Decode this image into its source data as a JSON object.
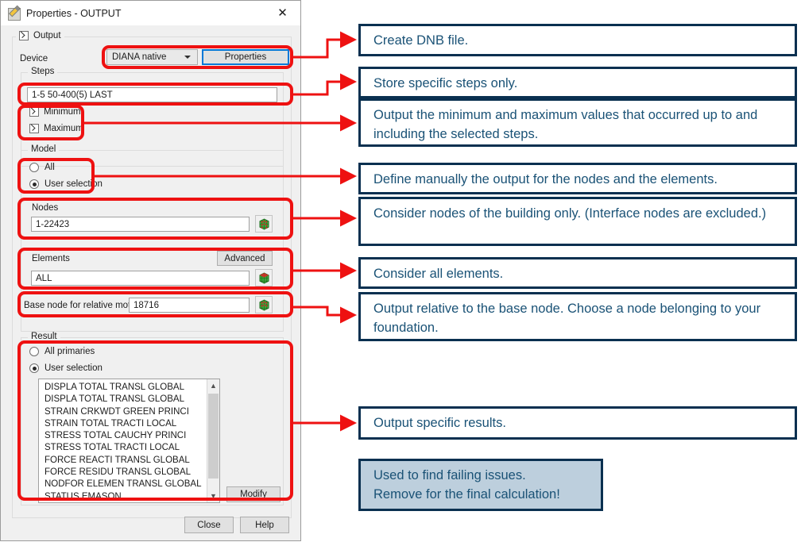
{
  "dialog": {
    "title": "Properties - OUTPUT",
    "title_icon": "properties-pencil-icon",
    "close_icon": "close-icon",
    "output_checkbox": {
      "label": "Output",
      "checked": true
    },
    "device": {
      "label": "Device",
      "selected": "DIANA native",
      "properties_button": "Properties",
      "dropdown_icon": "chevron-down-icon"
    },
    "steps": {
      "group_label": "Steps",
      "value": "1-5 50-400(5) LAST",
      "minimum": {
        "label": "Minimum",
        "checked": true
      },
      "maximum": {
        "label": "Maximum",
        "checked": true
      }
    },
    "model": {
      "group_label": "Model",
      "all": {
        "label": "All",
        "selected": false
      },
      "user_selection": {
        "label": "User selection",
        "selected": true
      },
      "nodes": {
        "label": "Nodes",
        "value": "1-22423",
        "pick_icon": "mesh-pick-icon"
      },
      "elements": {
        "label": "Elements",
        "value": "ALL",
        "advanced_button": "Advanced",
        "pick_icon": "mesh-pick-icon"
      },
      "base_node": {
        "label": "Base node for relative motion",
        "value": "18716",
        "pick_icon": "mesh-pick-icon"
      }
    },
    "result": {
      "group_label": "Result",
      "all_primaries": {
        "label": "All primaries",
        "selected": false
      },
      "user_selection": {
        "label": "User selection",
        "selected": true
      },
      "items": [
        "DISPLA TOTAL TRANSL GLOBAL",
        "DISPLA TOTAL TRANSL GLOBAL",
        "STRAIN CRKWDT GREEN PRINCI",
        "STRAIN TOTAL TRACTI LOCAL",
        "STRESS TOTAL CAUCHY PRINCI",
        "STRESS TOTAL TRACTI LOCAL",
        "FORCE REACTI TRANSL GLOBAL",
        "FORCE RESIDU TRANSL GLOBAL",
        "NODFOR ELEMEN TRANSL GLOBAL",
        "STATUS EMASON"
      ],
      "scroll_up_icon": "chevron-up-icon",
      "scroll_down_icon": "chevron-down-icon",
      "modify_button": "Modify"
    },
    "footer": {
      "close_button": "Close",
      "help_button": "Help"
    }
  },
  "annotations": [
    {
      "text": "Create DNB file."
    },
    {
      "text": "Store specific steps only."
    },
    {
      "text": "Output the minimum and maximum values that occurred up to and including the selected steps."
    },
    {
      "text": "Define manually the output for the nodes and the elements."
    },
    {
      "text": "Consider nodes of the building only. (Interface nodes are excluded.)"
    },
    {
      "text": "Consider all elements."
    },
    {
      "text": "Output relative to the base node. Choose a node belonging to your foundation."
    },
    {
      "text": "Output specific results."
    },
    {
      "text": "Used to find failing issues.\nRemove for the final calculation!"
    }
  ],
  "colors": {
    "highlight": "#ee1111",
    "note_border": "#0a3050",
    "note_text": "#1a5276",
    "note_fill": "#bdcfdd",
    "focus_blue": "#0078d7"
  }
}
